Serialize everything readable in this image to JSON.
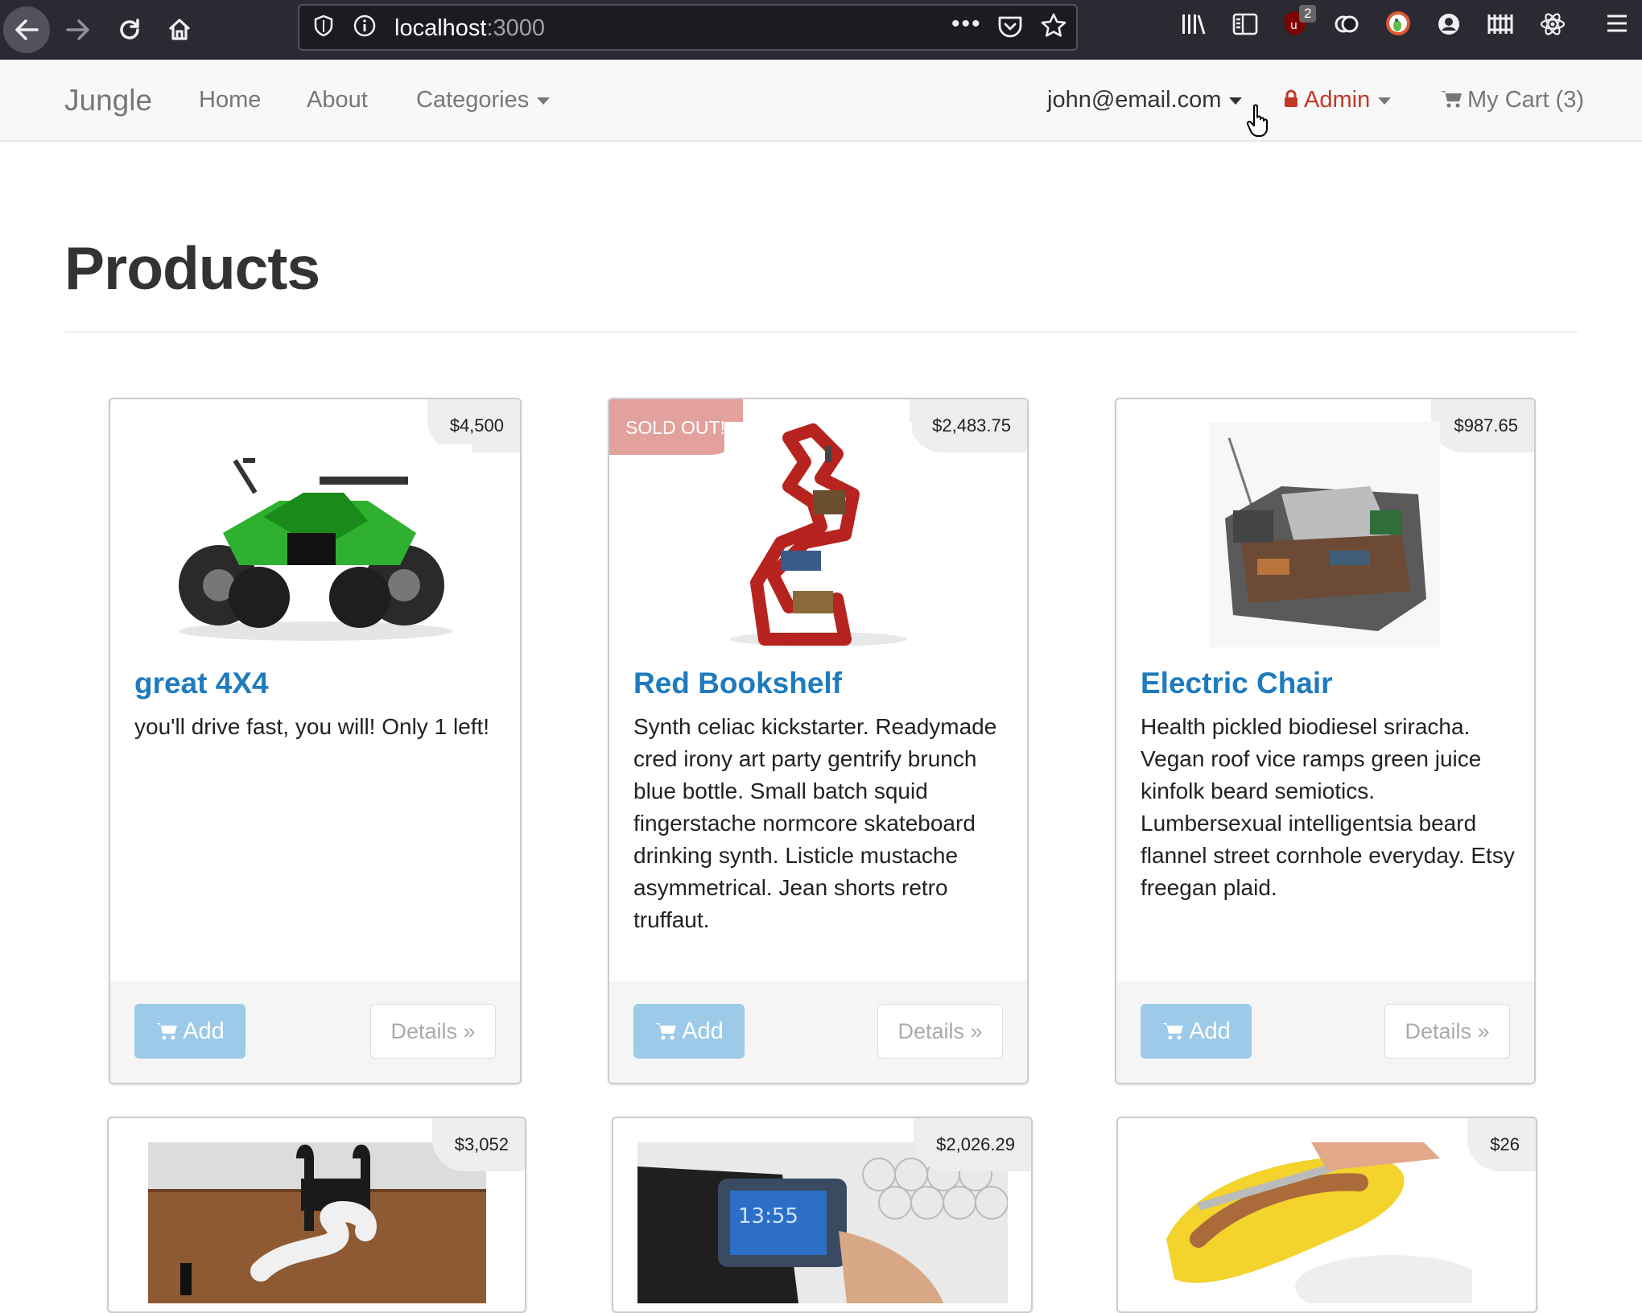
{
  "browser": {
    "url_host": "localhost",
    "url_port": ":3000",
    "badge": "2"
  },
  "navbar": {
    "brand": "Jungle",
    "home": "Home",
    "about": "About",
    "categories": "Categories",
    "user": "john@email.com",
    "admin": "Admin",
    "cart": "My Cart (3)"
  },
  "page": {
    "title": "Products"
  },
  "buttons": {
    "add": "Add",
    "details": "Details »"
  },
  "products": [
    {
      "name": "great 4X4",
      "price": "$4,500",
      "description": "you'll drive fast, you will! Only 1 left!"
    },
    {
      "name": "Red Bookshelf",
      "price": "$2,483.75",
      "sold_out": "SOLD OUT!",
      "description": "Synth celiac kickstarter. Readymade cred irony art party gentrify brunch blue bottle. Small batch squid fingerstache normcore skateboard drinking synth. Listicle mustache asymmetrical. Jean shorts retro truffaut."
    },
    {
      "name": "Electric Chair",
      "price": "$987.65",
      "description": "Health pickled biodiesel sriracha. Vegan roof vice ramps green juice kinfolk beard semiotics. Lumbersexual intelligentsia beard flannel street cornhole everyday. Etsy freegan plaid."
    },
    {
      "price": "$3,052"
    },
    {
      "price": "$2,026.29"
    },
    {
      "price": "$26"
    }
  ],
  "colors": {
    "link": "#1e7bbd",
    "admin": "#c0392b",
    "sold_out": "#e2a19c",
    "add_button": "#9ccae8"
  }
}
